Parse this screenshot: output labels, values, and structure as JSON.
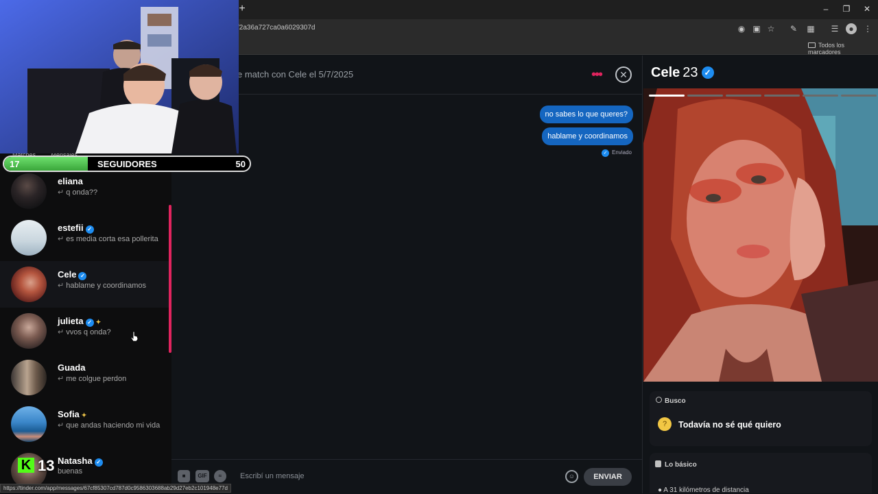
{
  "browser": {
    "url": "f2a36a727ca0a6029307d",
    "bookmarks_folder": "Todos los marcadores",
    "status_url": "https://tinder.com/app/messages/67cf85307cd787d0c9586303688ab29d27eb2c101948e77d"
  },
  "overlay": {
    "follower_current": "17",
    "follower_label": "SEGUIDORES",
    "follower_goal": "50",
    "follower_progress": 0.34,
    "kick_count": "13"
  },
  "sidebar": {
    "tabs": [
      "Matches",
      "Mensajes"
    ],
    "conversations": [
      {
        "name": "eliana",
        "preview": "q onda??",
        "verified": false,
        "spark": false
      },
      {
        "name": "estefii",
        "preview": "es media corta esa pollerita",
        "verified": true,
        "spark": false
      },
      {
        "name": "Cele",
        "preview": "hablame y coordinamos",
        "verified": true,
        "spark": false,
        "active": true
      },
      {
        "name": "julieta",
        "preview": "vvos q onda?",
        "verified": true,
        "spark": true
      },
      {
        "name": "Guada",
        "preview": "me colgue perdon",
        "verified": false,
        "spark": false
      },
      {
        "name": "Sofia",
        "preview": "que andas haciendo mi vida",
        "verified": false,
        "spark": true
      },
      {
        "name": "Natasha",
        "preview": "buenas",
        "verified": true,
        "spark": false
      }
    ]
  },
  "chat": {
    "match_text": "e match con Cele el 5/7/2025",
    "messages": [
      "no sabes lo que queres?",
      "hablame y coordinamos"
    ],
    "sent_status": "Enviado",
    "composer_placeholder": "Escribí un mensaje",
    "gif_label": "GIF",
    "send_label": "ENVIAR"
  },
  "profile": {
    "name": "Cele",
    "age": "23",
    "photo_count": 6,
    "photo_index": 1,
    "busco_label": "Busco",
    "busco_value": "Todavía no sé qué quiero",
    "basics_label": "Lo básico",
    "distance": "A 31 kilómetros de distancia"
  }
}
